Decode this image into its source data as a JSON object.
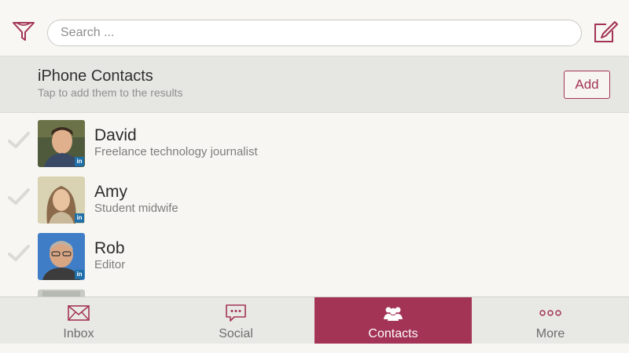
{
  "colors": {
    "accent": "#a33456",
    "linkedin": "#1f6fa8"
  },
  "header": {
    "search_placeholder": "Search ...",
    "filter_icon": "filter-funnel-icon",
    "compose_icon": "compose-icon"
  },
  "iphone_contacts": {
    "title": "iPhone Contacts",
    "subtitle": "Tap to add them to the results",
    "add_label": "Add"
  },
  "contacts": [
    {
      "name": "David",
      "role": "Freelance technology journalist",
      "badge": "in"
    },
    {
      "name": "Amy",
      "role": "Student midwife",
      "badge": "in"
    },
    {
      "name": "Rob",
      "role": "Editor",
      "badge": "in"
    }
  ],
  "tabs": [
    {
      "label": "Inbox",
      "icon": "envelope-icon",
      "active": false
    },
    {
      "label": "Social",
      "icon": "chat-bubble-icon",
      "active": false
    },
    {
      "label": "Contacts",
      "icon": "people-icon",
      "active": true
    },
    {
      "label": "More",
      "icon": "more-dots-icon",
      "active": false
    }
  ]
}
